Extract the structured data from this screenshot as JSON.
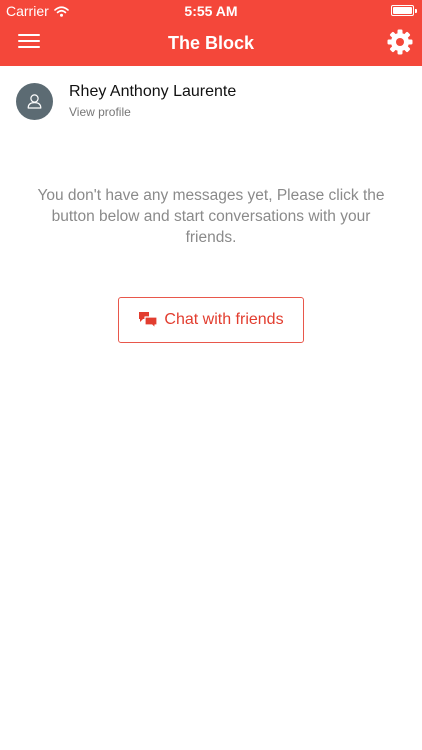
{
  "status_bar": {
    "carrier": "Carrier",
    "time": "5:55 AM",
    "wifi_icon": "wifi-icon",
    "battery_icon": "battery-icon",
    "battery_level": 1.0
  },
  "header": {
    "title": "The Block",
    "menu_icon": "hamburger-menu-icon",
    "settings_icon": "gear-icon",
    "background_color": "#f4473a"
  },
  "profile": {
    "name": "Rhey Anthony Laurente",
    "link_label": "View profile",
    "avatar_icon": "user-icon",
    "avatar_color": "#5c6b73"
  },
  "empty_state": {
    "message": "You don't have any messages yet, Please click the button below and start conversations with your friends."
  },
  "chat_button": {
    "label": "Chat with friends",
    "icon": "chat-bubbles-icon",
    "accent_color": "#e23d2f"
  }
}
